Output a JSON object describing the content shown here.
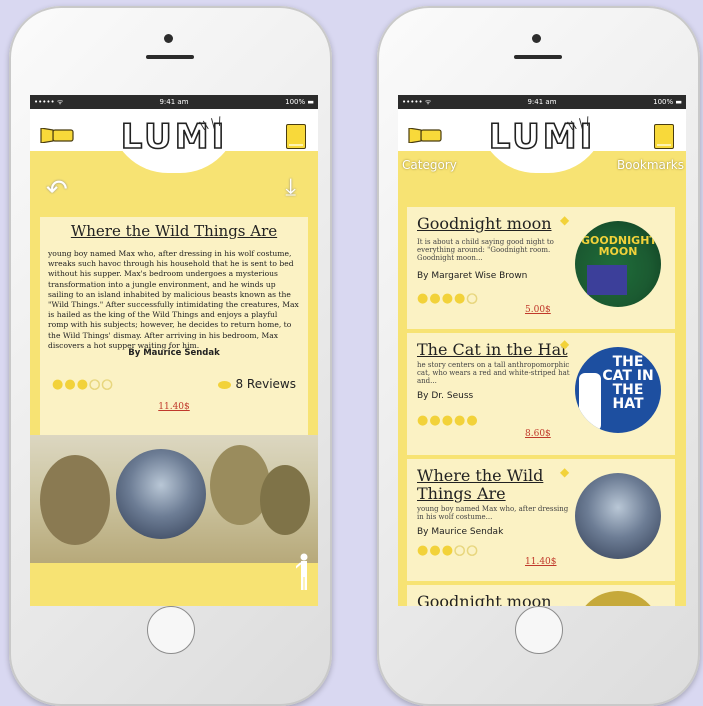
{
  "status": {
    "signal": "••••• ᯤ",
    "time": "9:41 am",
    "battery": "100% ▬"
  },
  "app": {
    "logo": "LUMI",
    "brand_color": "#f7e373",
    "card_color": "#fbf2c4"
  },
  "detail": {
    "title": "Where the Wild Things Are",
    "description": "young boy named Max who, after dressing in his wolf costume, wreaks such havoc through his household that he is sent to bed without his supper. Max's bedroom undergoes a mysterious transformation into a jungle environment, and he winds up sailing to an island inhabited by malicious beasts known as the \"Wild Things.\" After successfully intimidating the creatures, Max is hailed as the king of the Wild Things and enjoys a playful romp with his subjects; however, he decides to return home, to the Wild Things' dismay. After arriving in his bedroom, Max discovers a hot supper waiting for him.",
    "author": "By Maurice Sendak",
    "rating": 3,
    "rating_max": 5,
    "reviews": "8 Reviews",
    "price": "11.40$"
  },
  "list": {
    "category_label": "Category",
    "bookmarks_label": "Bookmarks",
    "items": [
      {
        "title": "Goodnight moon",
        "desc": "It is about a child saying good night to everything around: \"Goodnight room. Goodnight moon...",
        "author": "By Margaret Wise Brown",
        "rating": 4,
        "price": "5.00$",
        "cover_text": "GOODNIGHT MOON"
      },
      {
        "title": "The Cat in the Hat",
        "desc": "he story centers on a tall anthropomorphic cat, who wears a red and white-striped hat and...",
        "author": "By Dr. Seuss",
        "rating": 5,
        "price": "8.60$",
        "cover_text": "THE CAT IN THE HAT"
      },
      {
        "title": "Where the Wild Things Are",
        "desc": "young boy named Max who, after dressing in his wolf costume...",
        "author": "By Maurice Sendak",
        "rating": 3,
        "price": "11.40$",
        "cover_text": ""
      },
      {
        "title": "Goodnight moon",
        "desc": "",
        "author": "",
        "rating": 0,
        "price": "",
        "cover_text": ""
      }
    ]
  },
  "icons": {
    "flashlight": "flashlight-icon",
    "book": "book-icon",
    "back": "back-arrow-icon",
    "download": "download-icon",
    "bookmark": "bookmark-icon",
    "bulb": "lightbulb-icon"
  }
}
